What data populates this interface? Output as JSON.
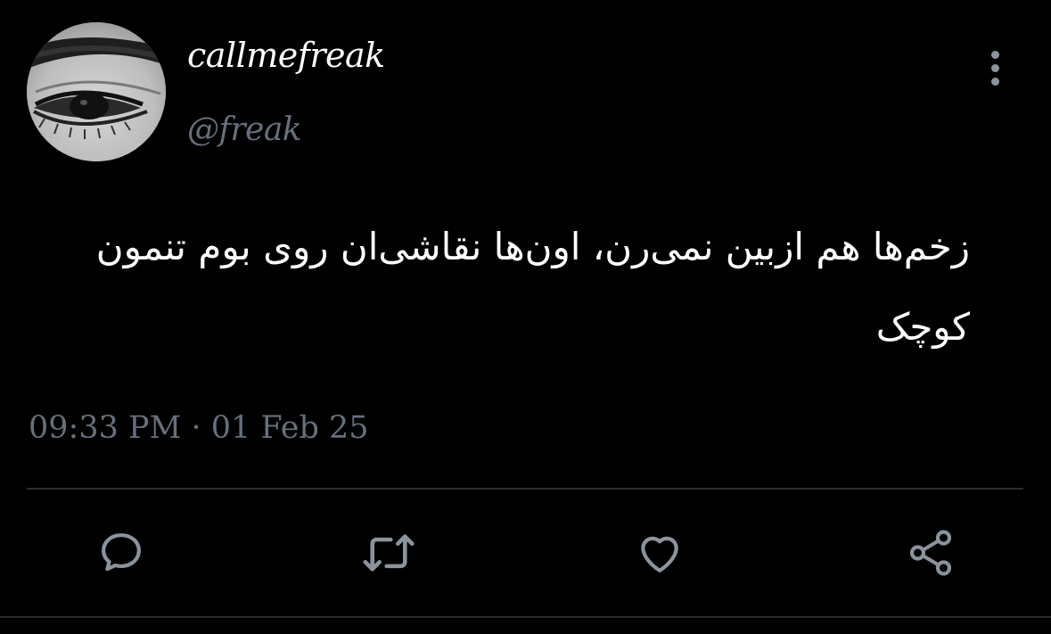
{
  "tweet": {
    "display_name": "callmefreak",
    "handle": "@freak",
    "text": "زخم‌ها هم ازبین نمی‌رن، اون‌ها نقاشی‌ان روی بوم تنمون کوچک",
    "timestamp": "09:33 PM · 01 Feb 25"
  },
  "colors": {
    "background": "#000000",
    "text": "#ffffff",
    "muted": "#66707c",
    "icon": "#8b939d",
    "divider": "#2a2d31"
  },
  "icons": {
    "more": "more-vertical-icon",
    "reply": "reply-bubble-icon",
    "retweet": "retweet-icon",
    "like": "heart-icon",
    "share": "share-icon"
  }
}
